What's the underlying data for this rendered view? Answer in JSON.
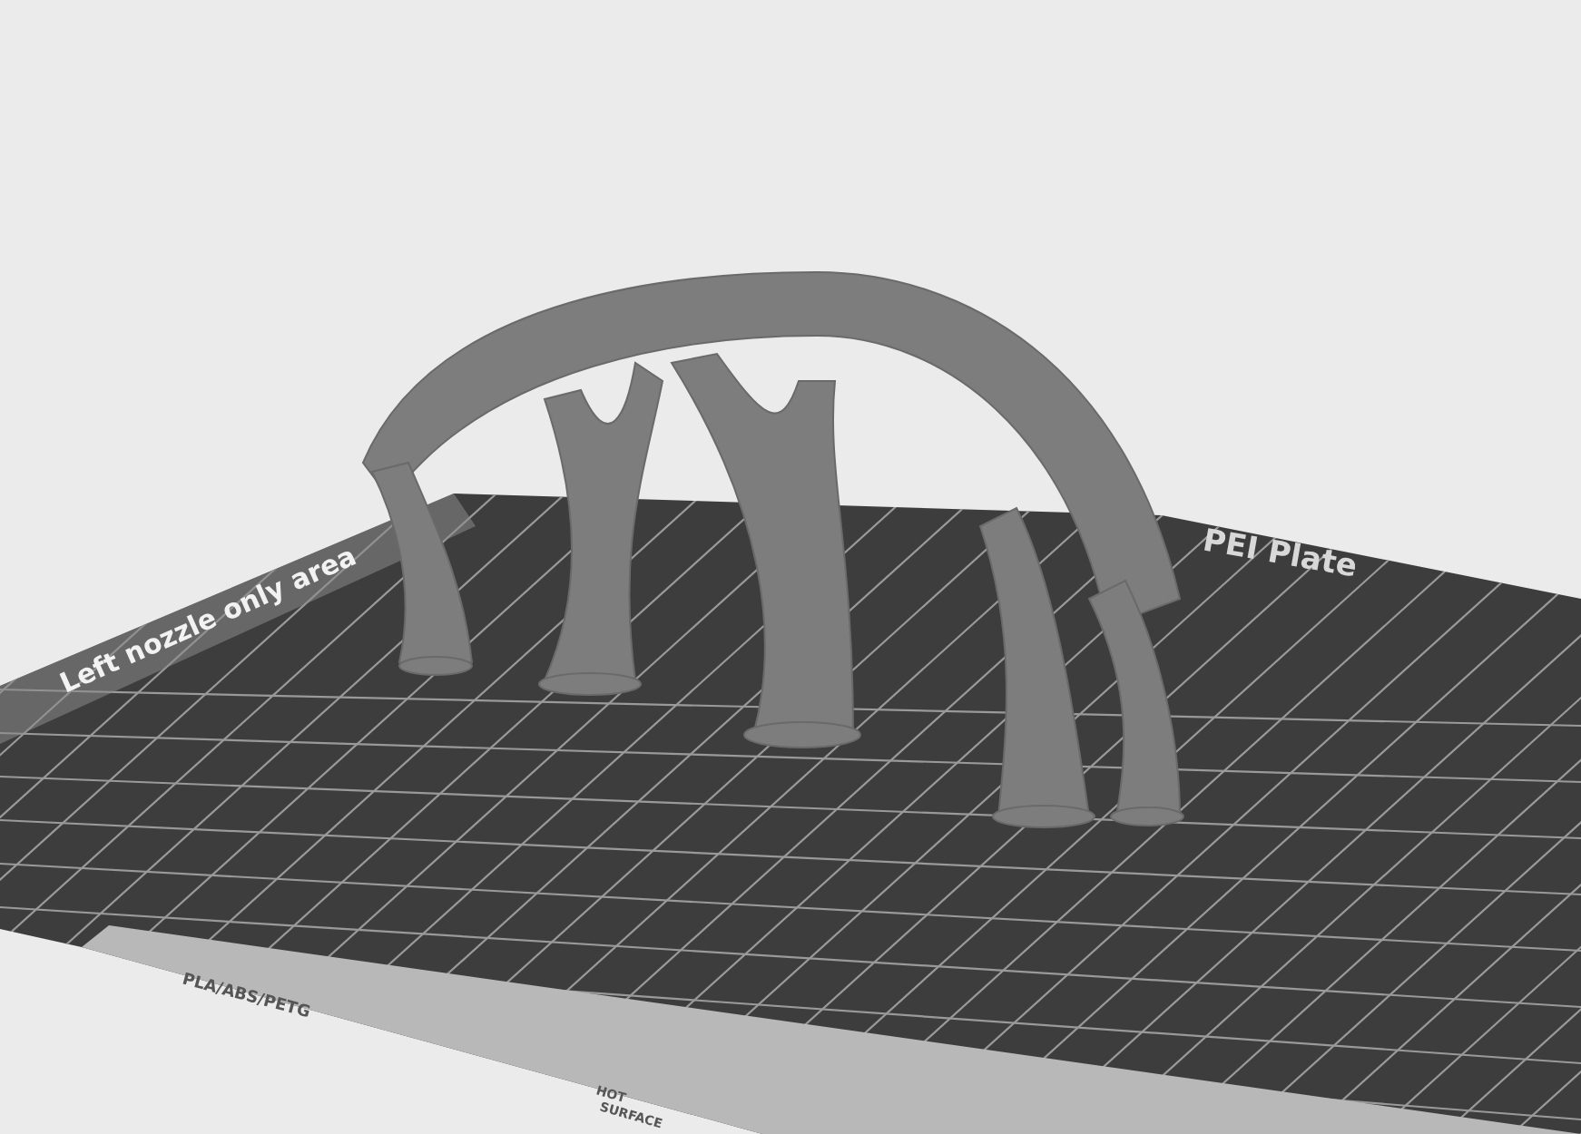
{
  "bed_labels": [
    {
      "kind": "zone",
      "text": "Left nozzle only area"
    },
    {
      "kind": "plate",
      "text": "PEI Plate"
    },
    {
      "kind": "strip",
      "text": "PLA/ABS/PETG"
    },
    {
      "kind": "strip",
      "text": "HOT"
    },
    {
      "kind": "strip",
      "text": "SURFACE"
    }
  ]
}
